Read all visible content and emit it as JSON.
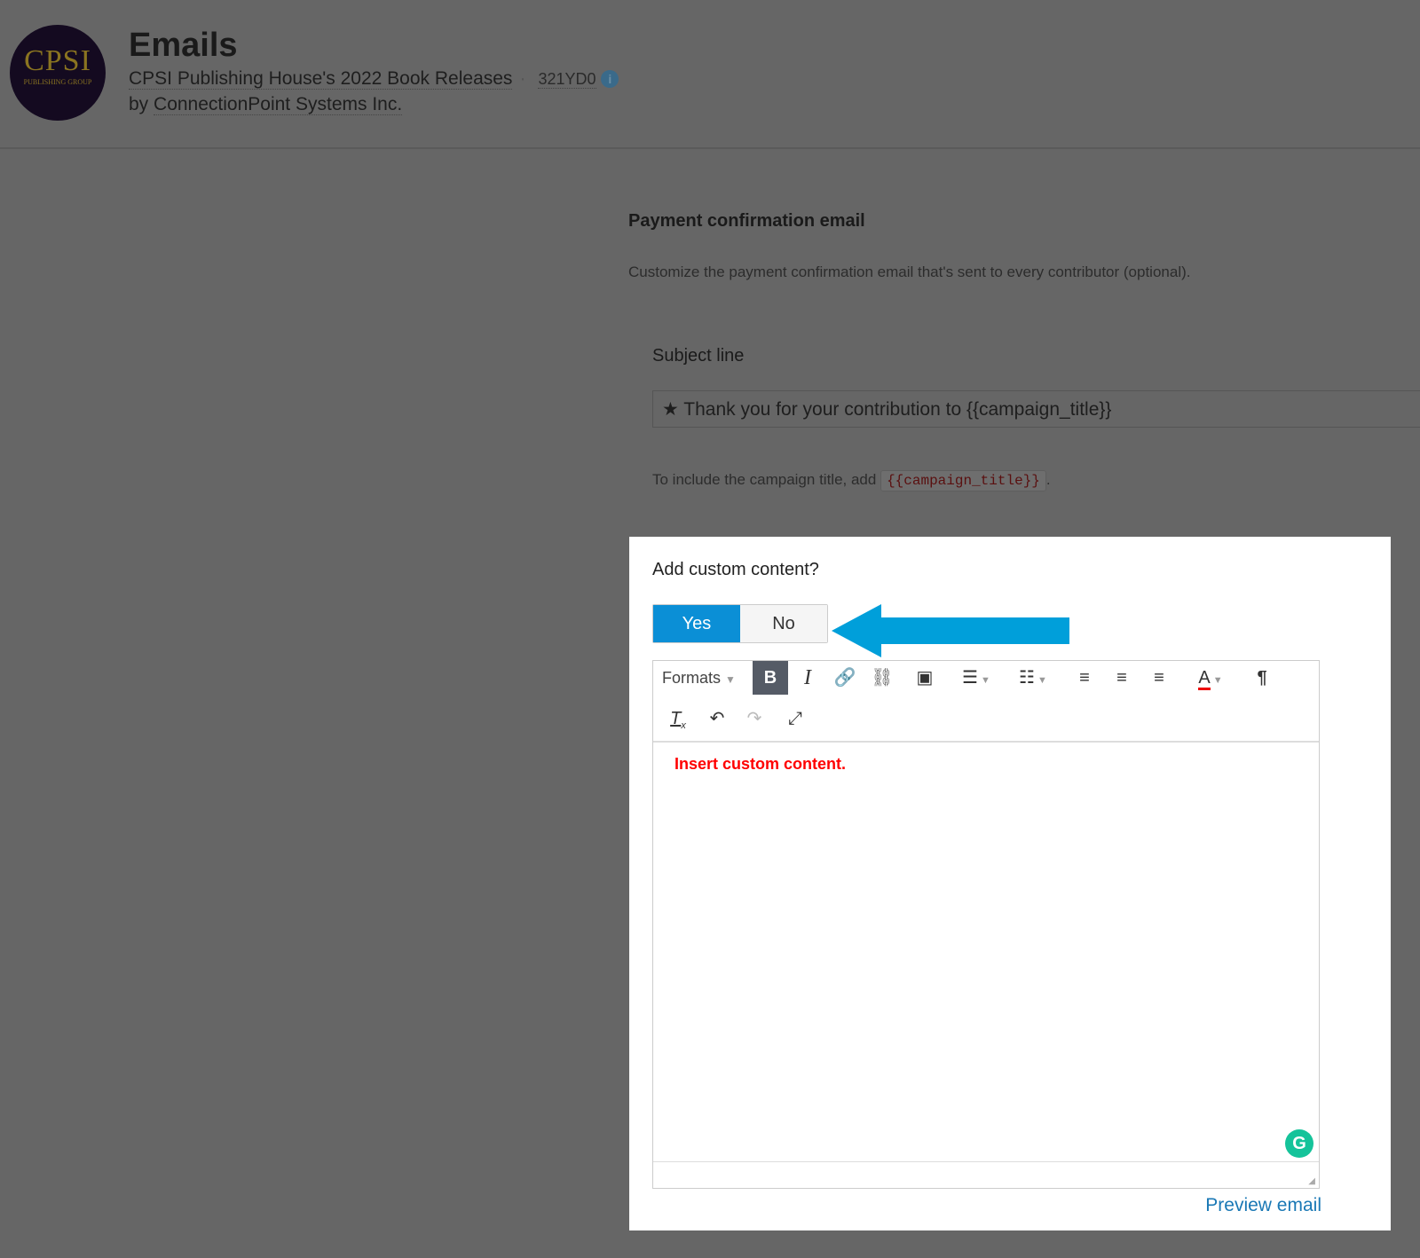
{
  "header": {
    "logo_text": "CPSI",
    "logo_sub": "PUBLISHING GROUP",
    "title": "Emails",
    "campaign": "CPSI Publishing House's 2022 Book Releases",
    "campaign_code": "321YD0",
    "info_icon": "info-icon",
    "owner_prefix": "by",
    "owner": "ConnectionPoint Systems Inc."
  },
  "section": {
    "title": "Payment confirmation email",
    "description": "Customize the payment confirmation email that's sent to every contributor (optional).",
    "subject_label": "Subject line",
    "subject_value": "★ Thank you for your contribution to {{campaign_title}}",
    "hint_text": "To include the campaign title, add",
    "hint_code": "{{campaign_title}}",
    "hint_end": "."
  },
  "custom": {
    "question": "Add custom content?",
    "yes": "Yes",
    "no": "No",
    "selected": "Yes",
    "arrow_color": "#009fda"
  },
  "editor": {
    "formats": "Formats",
    "content": "Insert custom content.",
    "preview": "Preview email"
  }
}
